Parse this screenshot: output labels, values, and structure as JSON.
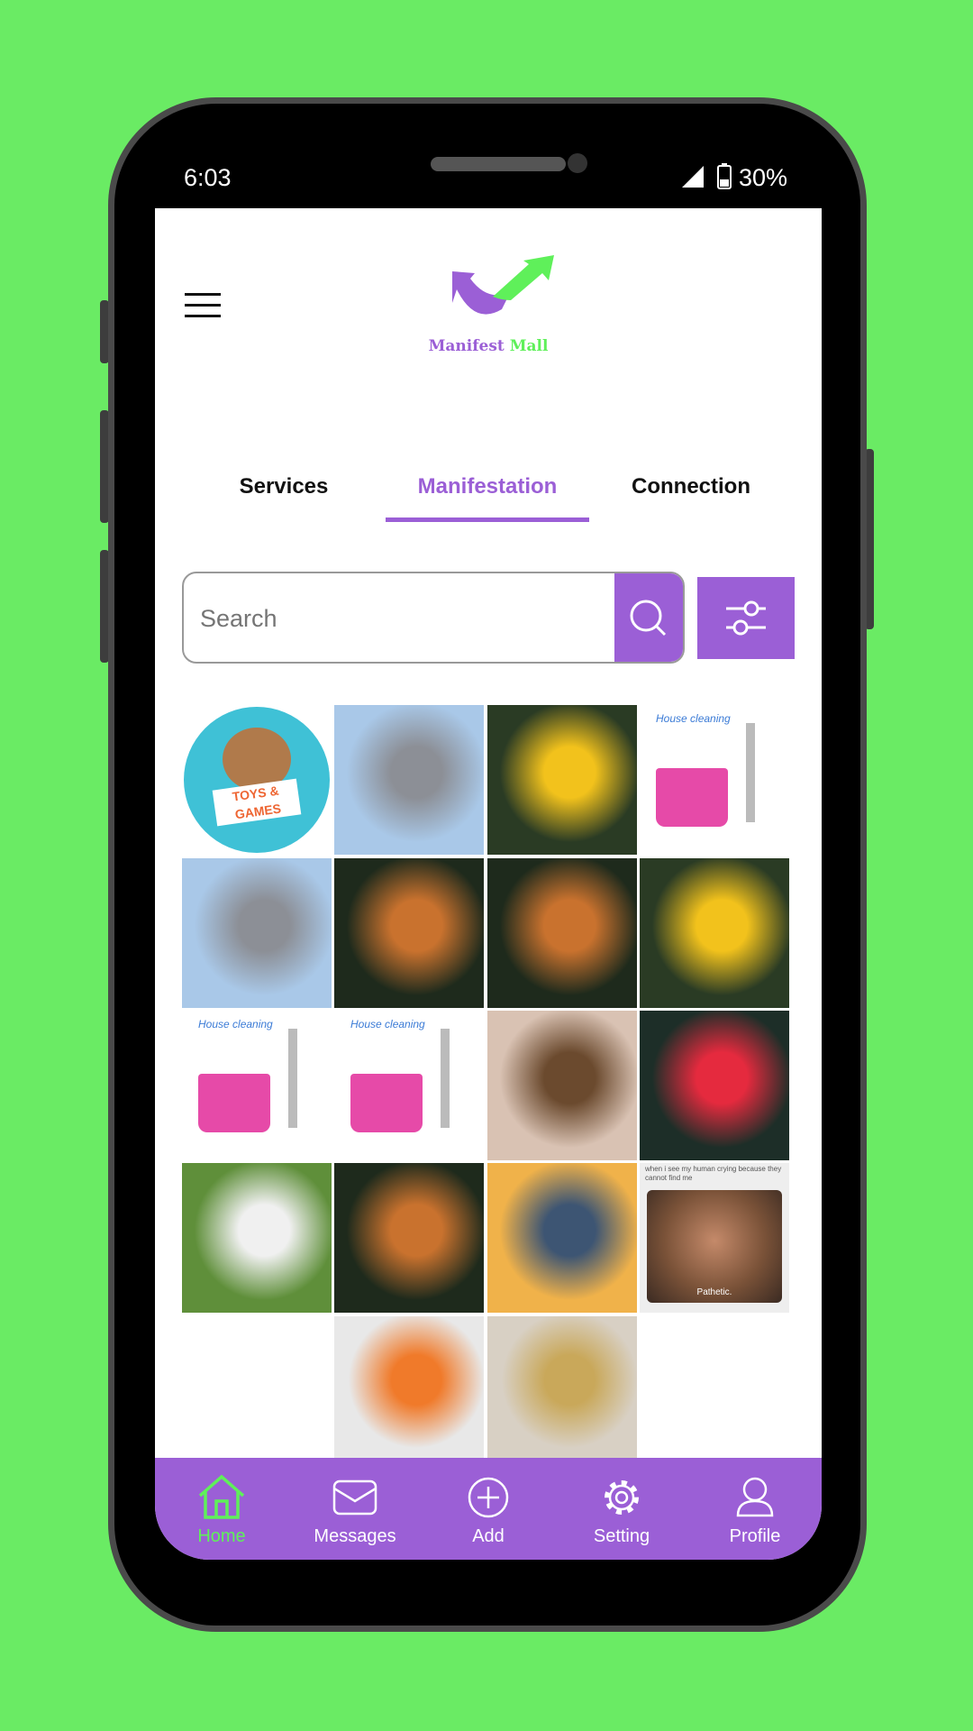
{
  "status_bar": {
    "time": "6:03",
    "battery": "30%"
  },
  "header": {
    "brand_part1": "Manifest",
    "brand_part2": "Mall"
  },
  "tabs": [
    {
      "label": "Services"
    },
    {
      "label": "Manifestation",
      "active": true
    },
    {
      "label": "Connection"
    }
  ],
  "search": {
    "placeholder": "Search"
  },
  "grid": [
    {
      "subject": "Toys & Games logo",
      "text": "TOYS & GAMES",
      "colors": [
        "#3fc1d6",
        "#b07a4b"
      ]
    },
    {
      "subject": "house",
      "colors": [
        "#a9c8e8",
        "#8c8f96"
      ]
    },
    {
      "subject": "sunflower",
      "colors": [
        "#2a3b24",
        "#f2c21c"
      ]
    },
    {
      "subject": "house cleaning illustration",
      "text": "House cleaning",
      "colors": [
        "#ffffff",
        "#e64aa8"
      ]
    },
    {
      "subject": "house",
      "colors": [
        "#a9c8e8",
        "#8c8f96"
      ]
    },
    {
      "subject": "tiger",
      "colors": [
        "#1e2a1c",
        "#c9722e"
      ]
    },
    {
      "subject": "tiger",
      "colors": [
        "#1e2a1c",
        "#c9722e"
      ]
    },
    {
      "subject": "sunflower",
      "colors": [
        "#2a3b24",
        "#f2c21c"
      ]
    },
    {
      "subject": "house cleaning illustration",
      "text": "House cleaning",
      "colors": [
        "#ffffff",
        "#e64aa8"
      ]
    },
    {
      "subject": "house cleaning illustration",
      "text": "House cleaning",
      "colors": [
        "#ffffff",
        "#e64aa8"
      ]
    },
    {
      "subject": "cat",
      "colors": [
        "#d9c2b3",
        "#6b4a2e"
      ]
    },
    {
      "subject": "red dahlia",
      "colors": [
        "#1d2e28",
        "#e52a3e"
      ]
    },
    {
      "subject": "white dog",
      "colors": [
        "#5f8f3a",
        "#f0f0f0"
      ]
    },
    {
      "subject": "tiger",
      "colors": [
        "#1e2a1c",
        "#c9722e"
      ]
    },
    {
      "subject": "sunset coast",
      "colors": [
        "#f0b24a",
        "#3d5573"
      ]
    },
    {
      "subject": "cat meme",
      "text": "when i see my human crying because they cannot find me",
      "caption": "Pathetic.",
      "colors": [
        "#eeeeee",
        "#7a5238"
      ]
    },
    {
      "subject": "cleaning supplies",
      "colors": [
        "#e8e8e8",
        "#f07a2a"
      ]
    },
    {
      "subject": "electrical wiring",
      "colors": [
        "#d8d0c4",
        "#c9a85a"
      ]
    }
  ],
  "nav": [
    {
      "label": "Home",
      "icon": "home-icon",
      "active": true
    },
    {
      "label": "Messages",
      "icon": "mail-icon"
    },
    {
      "label": "Add",
      "icon": "plus-circle-icon"
    },
    {
      "label": "Setting",
      "icon": "gear-icon"
    },
    {
      "label": "Profile",
      "icon": "user-icon"
    }
  ],
  "colors": {
    "accent": "#9b5fd6",
    "green": "#5ff05a",
    "background": "#6aeb64"
  }
}
